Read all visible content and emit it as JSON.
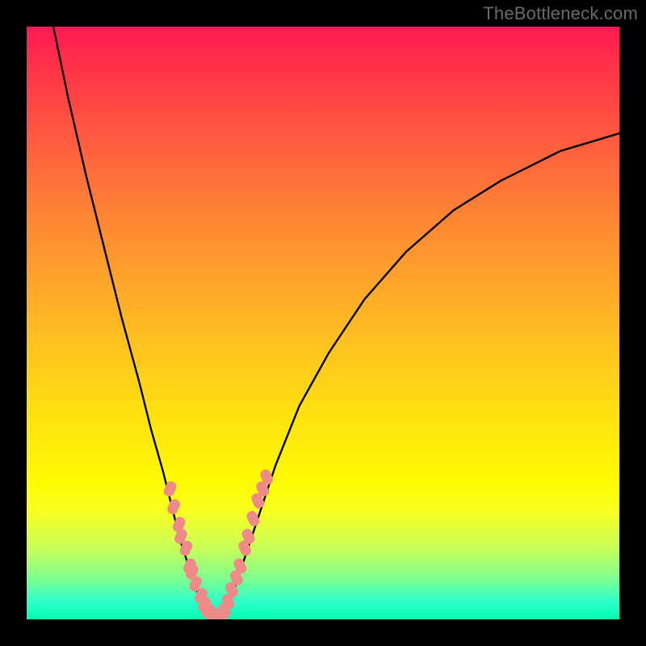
{
  "watermark_text": "TheBottleneck.com",
  "chart_data": {
    "type": "line",
    "title": "",
    "xlabel": "",
    "ylabel": "",
    "xlim": [
      0,
      100
    ],
    "ylim": [
      0,
      100
    ],
    "grid": false,
    "series": [
      {
        "name": "bottleneck-curve",
        "color": "#000000",
        "x": [
          4.5,
          7.0,
          10.0,
          13.0,
          16.0,
          19.0,
          21.0,
          23.0,
          25.0,
          26.0,
          27.0,
          28.0,
          29.0,
          30.0,
          31.0,
          32.0,
          32.5,
          33.0,
          34.0,
          35.0,
          37.0,
          39.0,
          42.0,
          46.0,
          51.0,
          57.0,
          64.0,
          72.0,
          80.0,
          90.0,
          100.0
        ],
        "y": [
          100,
          88,
          75,
          63,
          51,
          40,
          32,
          25,
          17,
          13,
          10,
          7,
          4,
          2,
          1,
          0,
          0,
          0,
          2,
          5,
          11,
          17,
          26,
          36,
          45,
          54,
          62,
          69,
          74,
          79,
          82
        ]
      }
    ],
    "markers": [
      {
        "name": "highlight-dots-left",
        "color": "#ee8a88",
        "x": [
          24.2,
          24.8,
          25.7,
          26.0,
          26.9,
          27.5,
          27.9,
          28.5,
          29.4,
          30.0,
          30.6,
          31.4,
          32.0
        ],
        "y": [
          22,
          19,
          16,
          14,
          12,
          9,
          8,
          6,
          4,
          2.5,
          1.5,
          0.7,
          0.3
        ]
      },
      {
        "name": "highlight-dots-right",
        "color": "#ee8a88",
        "x": [
          32.8,
          33.4,
          34.0,
          34.6,
          35.4,
          36.0,
          36.8,
          37.4,
          38.2,
          39.0,
          39.8,
          40.5
        ],
        "y": [
          0.4,
          1.5,
          3,
          5,
          7,
          9,
          12,
          14,
          17,
          20,
          22,
          24
        ]
      }
    ],
    "background_gradient": {
      "top": "#ff1a53",
      "mid": "#ffe210",
      "bottom": "#00ffb0"
    }
  }
}
